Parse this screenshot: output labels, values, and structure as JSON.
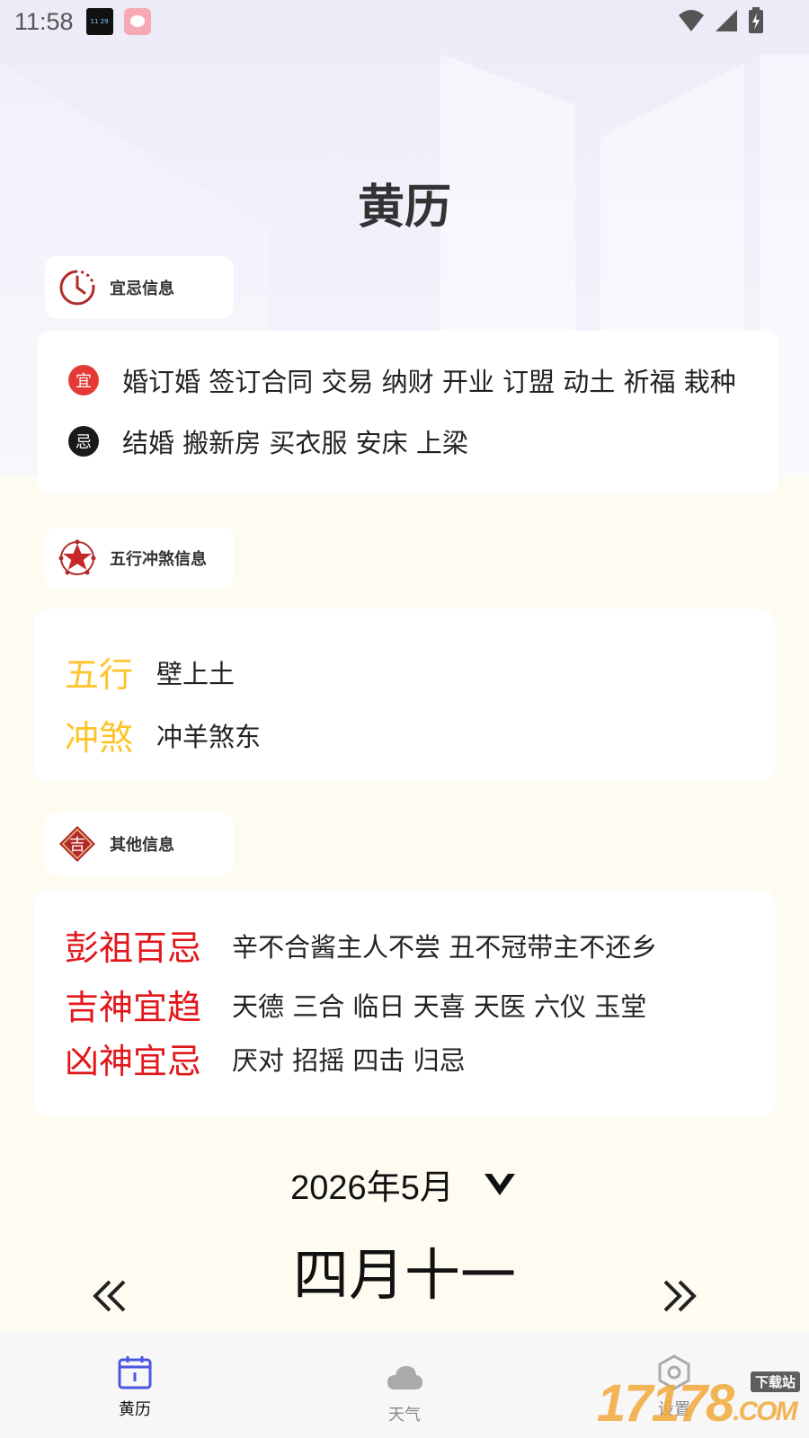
{
  "status_bar": {
    "time": "11:58",
    "app_icon_1_text": "11 29 03"
  },
  "page": {
    "title": "黄历"
  },
  "yiji": {
    "section_label": "宜忌信息",
    "yi_badge": "宜",
    "yi_text": "婚订婚 签订合同 交易 纳财 开业 订盟 动土 祈福 栽种",
    "ji_badge": "忌",
    "ji_text": "结婚 搬新房 买衣服 安床 上梁"
  },
  "wuxing": {
    "section_label": "五行冲煞信息",
    "rows": [
      {
        "key": "五行",
        "value": "壁上土"
      },
      {
        "key": "冲煞",
        "value": "冲羊煞东"
      }
    ]
  },
  "other": {
    "section_label": "其他信息",
    "icon_char": "吉",
    "rows": [
      {
        "key": "彭祖百忌",
        "value": "辛不合酱主人不尝 丑不冠带主不还乡"
      },
      {
        "key": "吉神宜趋",
        "value": "天德 三合 临日 天喜 天医 六仪 玉堂"
      },
      {
        "key": "凶神宜忌",
        "value": "厌对 招摇 四击 归忌"
      }
    ]
  },
  "calendar": {
    "month": "2026年5月",
    "lunar_day": "四月十一"
  },
  "tabs": [
    {
      "label": "黄历",
      "active": true
    },
    {
      "label": "天气",
      "active": false
    },
    {
      "label": "设置",
      "active": false
    }
  ],
  "watermark": {
    "text": "17178",
    "suffix": ".COM",
    "tag": "下载站"
  },
  "colors": {
    "accent_tab": "#4c56e0",
    "yi_red": "#e53935",
    "ji_black": "#1a1a1a",
    "wuxing_yellow": "#ffc42a",
    "other_red": "#e3161a"
  }
}
